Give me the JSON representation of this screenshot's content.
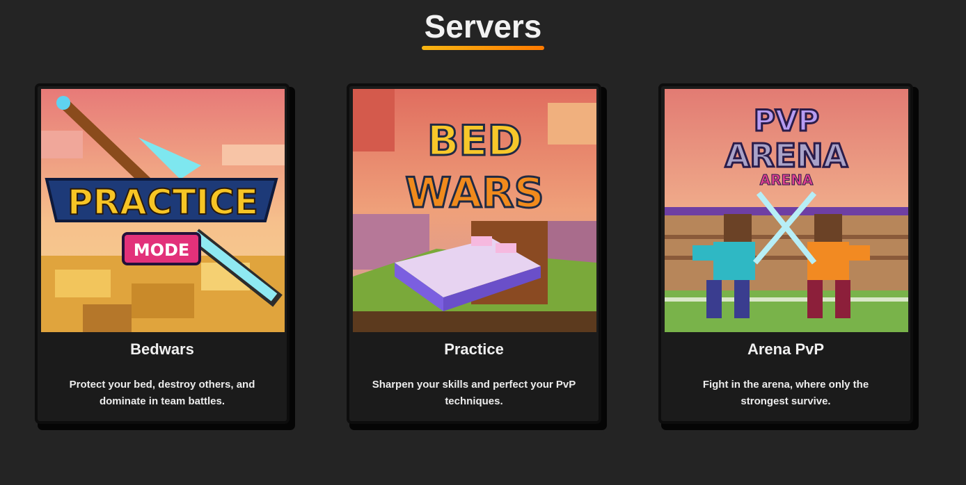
{
  "heading": {
    "title": "Servers"
  },
  "cards": [
    {
      "title": "Bedwars",
      "description": "Protect your bed, destroy others, and dominate in team battles.",
      "image": {
        "icon": "practice-mode-logo-icon",
        "line1": "PRACTICE",
        "line2": "MODE"
      }
    },
    {
      "title": "Practice",
      "description": "Sharpen your skills and perfect your PvP techniques.",
      "image": {
        "icon": "bed-wars-logo-icon",
        "line1": "BED",
        "line2": "WARS"
      }
    },
    {
      "title": "Arena PvP",
      "description": "Fight in the arena, where only the strongest survive.",
      "image": {
        "icon": "pvp-arena-logo-icon",
        "line1": "PVP",
        "line2": "ARENA",
        "line3": "ARENA"
      }
    }
  ],
  "colors": {
    "background": "#242424",
    "card": "#1b1b1b",
    "accent_start": "#f7b512",
    "accent_end": "#ff7a00"
  }
}
